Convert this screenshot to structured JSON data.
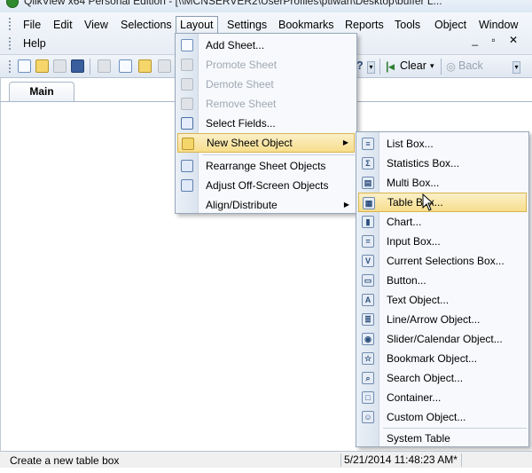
{
  "window": {
    "title": "QlikView x64 Personal Edition - [\\\\MCNSERVER2\\UserProfiles\\ptiwari\\Desktop\\buffer L..."
  },
  "menubar": {
    "items": [
      "File",
      "Edit",
      "View",
      "Selections",
      "Layout",
      "Settings",
      "Bookmarks",
      "Reports",
      "Tools",
      "Object",
      "Window",
      "Help"
    ],
    "mdi_controls": "_ ▫ ✕"
  },
  "toolbar": {
    "clear_label": "Clear",
    "back_label": "Back"
  },
  "sheet": {
    "tab_label": "Main"
  },
  "layout_menu": {
    "items": [
      {
        "label": "Add Sheet...",
        "enabled": true
      },
      {
        "label": "Promote Sheet",
        "enabled": false
      },
      {
        "label": "Demote Sheet",
        "enabled": false
      },
      {
        "label": "Remove Sheet",
        "enabled": false
      },
      {
        "label": "Select Fields...",
        "enabled": true
      },
      {
        "label": "New Sheet Object",
        "enabled": true,
        "submenu": true
      },
      {
        "label": "Rearrange Sheet Objects",
        "enabled": true
      },
      {
        "label": "Adjust Off-Screen Objects",
        "enabled": true
      },
      {
        "label": "Align/Distribute",
        "enabled": true,
        "submenu": true
      }
    ]
  },
  "new_sheet_object_menu": {
    "items": [
      {
        "label": "List Box...",
        "icon": "list-box-icon",
        "glyph": "≡"
      },
      {
        "label": "Statistics Box...",
        "icon": "statistics-box-icon",
        "glyph": "Σ"
      },
      {
        "label": "Multi Box...",
        "icon": "multi-box-icon",
        "glyph": "▤"
      },
      {
        "label": "Table Box...",
        "icon": "table-box-icon",
        "glyph": "▦"
      },
      {
        "label": "Chart...",
        "icon": "chart-icon",
        "glyph": "▮"
      },
      {
        "label": "Input Box...",
        "icon": "input-box-icon",
        "glyph": "="
      },
      {
        "label": "Current Selections Box...",
        "icon": "current-selections-icon",
        "glyph": "V"
      },
      {
        "label": "Button...",
        "icon": "button-icon",
        "glyph": "▭"
      },
      {
        "label": "Text Object...",
        "icon": "text-object-icon",
        "glyph": "A"
      },
      {
        "label": "Line/Arrow Object...",
        "icon": "line-arrow-icon",
        "glyph": "≣"
      },
      {
        "label": "Slider/Calendar Object...",
        "icon": "slider-calendar-icon",
        "glyph": "◉"
      },
      {
        "label": "Bookmark Object...",
        "icon": "bookmark-object-icon",
        "glyph": "☆"
      },
      {
        "label": "Search Object...",
        "icon": "search-object-icon",
        "glyph": "⌕"
      },
      {
        "label": "Container...",
        "icon": "container-icon",
        "glyph": "□"
      },
      {
        "label": "Custom Object...",
        "icon": "custom-object-icon",
        "glyph": "☺"
      },
      {
        "label": "System Table",
        "icon": "",
        "glyph": ""
      }
    ]
  },
  "statusbar": {
    "hint": "Create a new table box",
    "timestamp": "5/21/2014 11:48:23 AM*"
  }
}
